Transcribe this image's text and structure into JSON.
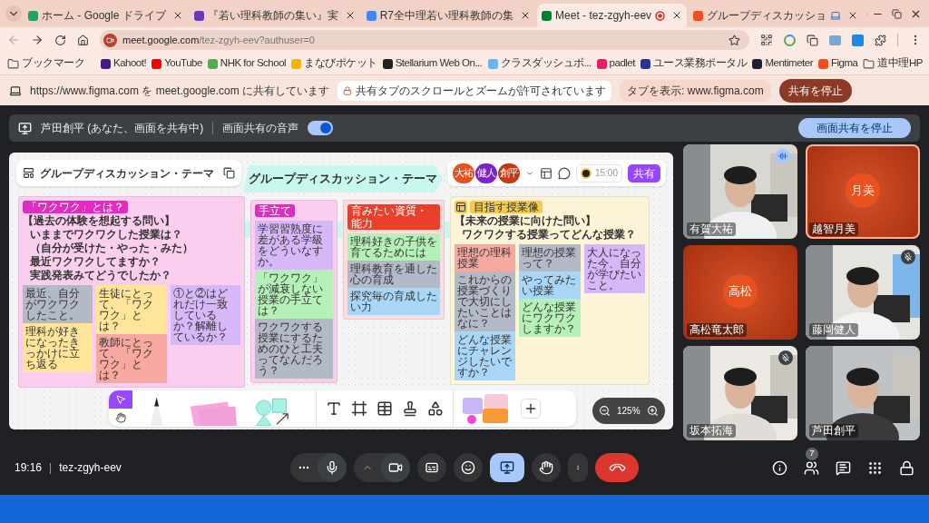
{
  "browser": {
    "tabs": [
      {
        "title": "ホーム - Google ドライブ",
        "kind": "drive",
        "selected": false
      },
      {
        "title": "『若い理科教師の集い』実",
        "kind": "forms",
        "selected": false
      },
      {
        "title": "R7全中理若い理科教師の集",
        "kind": "docs",
        "selected": false
      },
      {
        "title": "Meet - tez-zgyh-eev",
        "kind": "meet",
        "selected": true,
        "recording": true
      },
      {
        "title": "グループディスカッショ",
        "kind": "figma",
        "selected": false,
        "casting": true
      }
    ],
    "address": {
      "host": "meet.google.com",
      "path": "/tez-zgyh-eev?authuser=0"
    },
    "bookmarks": [
      {
        "label": "ブックマーク",
        "kind": "folder"
      },
      {
        "label": "Kahoot!",
        "kind": "kahoot"
      },
      {
        "label": "YouTube",
        "kind": "youtube"
      },
      {
        "label": "NHK for School",
        "kind": "nhk"
      },
      {
        "label": "まなびポケット",
        "kind": "manabi"
      },
      {
        "label": "Stellarium Web On...",
        "kind": "stellarium"
      },
      {
        "label": "クラスダッシュボ...",
        "kind": "classdash"
      },
      {
        "label": "padlet",
        "kind": "padlet"
      },
      {
        "label": "ユース業務ポータル",
        "kind": "portal"
      },
      {
        "label": "Mentimeter",
        "kind": "menti"
      },
      {
        "label": "Figma",
        "kind": "figma"
      },
      {
        "label": "道中理HP",
        "kind": "folder"
      }
    ]
  },
  "share_infobar": {
    "message": "https://www.figma.com を meet.google.com に共有しています",
    "notice": "共有タブのスクロールとズームが許可されています",
    "switch_tab": "タブを表示: www.figma.com",
    "stop": "共有を停止"
  },
  "meet": {
    "presenting_bar": {
      "presenter": "芦田創平 (あなた、画面を共有中)",
      "audio_label": "画面共有の音声",
      "audio_on": true,
      "stop": "画面共有を停止"
    },
    "figma": {
      "file_name": "グループディスカッション・テーマ",
      "title": "グループディスカッション・テーマ",
      "avatars": [
        {
          "text": "大祐",
          "color": "#e8501e"
        },
        {
          "text": "健人",
          "color": "#7b22c9"
        },
        {
          "text": "創平",
          "color": "#c43a14"
        }
      ],
      "timer": "15:00",
      "share": "共有",
      "sections": [
        {
          "tag": {
            "text": "「ワクワク」とは？",
            "color": "#e22bc0"
          },
          "color": "#fbcdee",
          "question": [
            "【過去の体験を想起する問い】",
            "いままでワクワクした授業は？",
            "（自分が受けた・やった・みた）",
            "最近ワクワクしてますか？",
            "実践発表みてどうでしたか？"
          ],
          "columns": [
            [
              {
                "text": "最近、自分がワクワクしたこと。",
                "color": "#b3b9c6"
              },
              {
                "text": "理科が好きになったきっかけに立ち返る",
                "color": "#ffe49a"
              }
            ],
            [
              {
                "text": "生徒にとって、「ワクワク」とは？",
                "color": "#ffe49a"
              },
              {
                "text": "教師にとって、「ワクワク」とは？",
                "color": "#f7a8a0"
              }
            ],
            [
              {
                "text": "①と②はどれだけ一致しているか？解離しているか？",
                "color": "#d6b7f7"
              }
            ]
          ]
        },
        {
          "tag": {
            "text": "手立て",
            "color": "#e22bc0"
          },
          "color": "#fbcdee",
          "columns": [
            [
              {
                "text": "学習習熟度に差がある学級をどういなすか。",
                "color": "#d6b7f7"
              },
              {
                "text": "「ワクワク」が減衰しない授業の手立ては？",
                "color": "#b5f0b8"
              },
              {
                "text": "ワクワクする授業にするためのひと工夫ってなんだろう？",
                "color": "#b3b9c6"
              }
            ]
          ]
        },
        {
          "tag": {
            "text": "育みたい資質・能力",
            "color": "#e8402a"
          },
          "color": "#fcdcdc",
          "columns": [
            [
              {
                "text": "理科好きの子供を育てるためには",
                "color": "#b5f0b8"
              },
              {
                "text": "理科教育を通した心の育成",
                "color": "#b3b9c6"
              },
              {
                "text": "探究毎の育成したい力",
                "color": "#a9d6f7"
              }
            ]
          ]
        },
        {
          "tag": {
            "text": "目指す授業像",
            "color": "#f7c948"
          },
          "color": "#fdf3d6",
          "question": [
            "【未来の授業に向けた問い】",
            "ワクワクする授業ってどんな授業？"
          ],
          "columns": [
            [
              {
                "text": "理想の理科授業",
                "color": "#f7a8a0"
              },
              {
                "text": "これからの授業づくりで大切にしたいことはなに？",
                "color": "#b3b9c6"
              },
              {
                "text": "どんな授業にチャレンジしたいですか？",
                "color": "#a9d6f7"
              }
            ],
            [
              {
                "text": "理想の授業って？",
                "color": "#b3b9c6"
              },
              {
                "text": "やってみたい授業",
                "color": "#a9d6f7"
              },
              {
                "text": "どんな授業にワクワクしますか？",
                "color": "#b5f0b8"
              }
            ],
            [
              {
                "text": "大人になった今、自分が学びたいこと。",
                "color": "#d6b7f7"
              }
            ]
          ]
        }
      ],
      "tools": [
        {
          "kind": "move",
          "selected": true
        },
        {
          "kind": "hand",
          "selected": false
        }
      ],
      "zoom": "125%"
    },
    "participants": [
      {
        "name": "有賀大祐",
        "kind": "video",
        "speaking": true,
        "muted": false,
        "highlighted": false
      },
      {
        "name": "高松竜太郎",
        "kind": "avatar",
        "avatar_text": "高松",
        "speaking": false,
        "muted": false,
        "highlighted": false
      },
      {
        "name": "坂本拓海",
        "kind": "video",
        "speaking": false,
        "muted": true,
        "highlighted": false
      },
      {
        "name": "越智月美",
        "kind": "avatar",
        "avatar_text": "月美",
        "speaking": false,
        "muted": false,
        "highlighted": true
      },
      {
        "name": "藤岡健人",
        "kind": "video",
        "speaking": false,
        "muted": true,
        "highlighted": false
      },
      {
        "name": "芦田創平",
        "kind": "video",
        "speaking": false,
        "muted": false,
        "highlighted": false
      }
    ],
    "bottom_bar": {
      "time": "19:16",
      "separator": "|",
      "meeting_code": "tez-zgyh-eev",
      "people_count": "7",
      "presenting": true
    }
  }
}
